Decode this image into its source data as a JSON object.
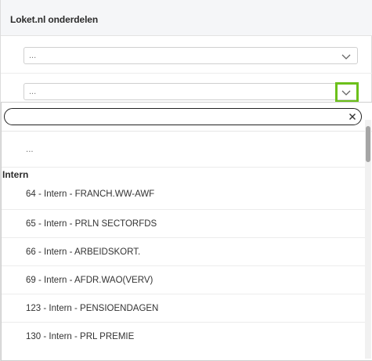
{
  "header": {
    "title": "Loket.nl onderdelen"
  },
  "select_1": {
    "value": "..."
  },
  "select_2": {
    "value": "..."
  },
  "dropdown": {
    "search": {
      "value": "",
      "placeholder": ""
    },
    "placeholder_option": "...",
    "group": {
      "label": "Intern",
      "options": [
        "64 - Intern - FRANCH.WW-AWF",
        "65 - Intern - PRLN SECTORFDS",
        "66 - Intern - ARBEIDSKORT.",
        "69 - Intern - AFDR.WAO(VERV)",
        "123 - Intern - PENSIOENDAGEN",
        "130 - Intern - PRL PREMIE"
      ]
    }
  },
  "colors": {
    "highlight": "#6cc01b",
    "header_bg": "#f5f6f8"
  }
}
